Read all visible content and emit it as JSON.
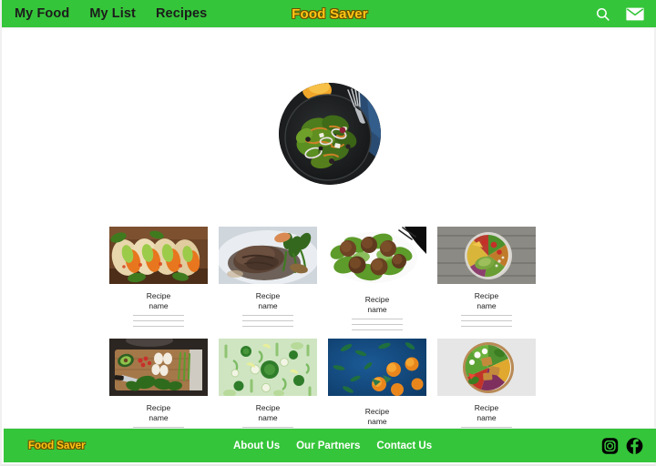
{
  "header": {
    "brand": "Food Saver",
    "nav": [
      {
        "label": "My Food"
      },
      {
        "label": "My List"
      },
      {
        "label": "Recipes"
      }
    ],
    "actions": [
      {
        "name": "search-icon",
        "label": "Search"
      },
      {
        "name": "mail-icon",
        "label": "Mail"
      }
    ],
    "background_color": "#35c53a",
    "brand_color": "#fec615",
    "nav_text_color": "#1c1c1c"
  },
  "hero": {
    "alt": "Salad bowl on dark plate with fork",
    "shape": "circle"
  },
  "recipes": [
    {
      "title": "Recipe\nname",
      "line1": "Recipe",
      "line2": "name",
      "image": "tacos",
      "low": false
    },
    {
      "title": "Recipe name",
      "line1": "Recipe",
      "line2": "name",
      "image": "steak-broccolini",
      "low": false
    },
    {
      "title": "Recipe name",
      "line1": "Recipe",
      "line2": "name",
      "image": "meatballs-salad",
      "low": true
    },
    {
      "title": "Recipe name",
      "line1": "Recipe",
      "line2": "name",
      "image": "veggie-bowl-wood",
      "low": false
    },
    {
      "title": "Recipe name",
      "line1": "Recipe",
      "line2": "name",
      "image": "cutting-board",
      "low": false
    },
    {
      "title": "Recipe name",
      "line1": "Recipe",
      "line2": "name",
      "image": "green-vegetables",
      "low": false
    },
    {
      "title": "Recipe name",
      "line1": "Recipe",
      "line2": "name",
      "image": "oranges-blue",
      "low": true
    },
    {
      "title": "Recipe name",
      "line1": "Recipe",
      "line2": "name",
      "image": "buddha-bowl",
      "low": false
    }
  ],
  "footer": {
    "brand": "Food Saver",
    "links": [
      {
        "label": "About Us"
      },
      {
        "label": "Our Partners"
      },
      {
        "label": "Contact Us"
      }
    ],
    "social": [
      {
        "name": "instagram-icon",
        "label": "Instagram"
      },
      {
        "name": "facebook-icon",
        "label": "Facebook"
      }
    ],
    "background_color": "#35c53a",
    "brand_color": "#fec615",
    "link_color": "#ffffff",
    "social_color": "#000000"
  }
}
